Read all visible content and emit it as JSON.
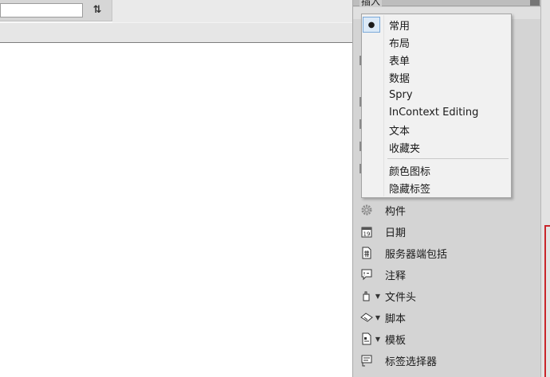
{
  "toolbar": {
    "search_value": "",
    "sort_icon_glyph": "⇅"
  },
  "panel": {
    "title": "插入",
    "items": [
      {
        "label": "构件",
        "icon": "widget-gear-icon",
        "caret": false
      },
      {
        "label": "日期",
        "icon": "calendar-date-icon",
        "caret": false
      },
      {
        "label": "服务器端包括",
        "icon": "server-include-icon",
        "caret": false
      },
      {
        "label": "注释",
        "icon": "comment-icon",
        "caret": false
      },
      {
        "label": "文件头",
        "icon": "file-head-icon",
        "caret": true
      },
      {
        "label": "脚本",
        "icon": "script-icon",
        "caret": true
      },
      {
        "label": "模板",
        "icon": "template-icon",
        "caret": true
      },
      {
        "label": "标签选择器",
        "icon": "tag-chooser-icon",
        "caret": false
      }
    ]
  },
  "dropdown": {
    "selected_mark": "●",
    "items": [
      {
        "label": "常用",
        "selected": true
      },
      {
        "label": "布局",
        "selected": false
      },
      {
        "label": "表单",
        "selected": false
      },
      {
        "label": "数据",
        "selected": false
      },
      {
        "label": "Spry",
        "selected": false
      },
      {
        "label": "InContext Editing",
        "selected": false
      },
      {
        "label": "文本",
        "selected": false
      },
      {
        "label": "收藏夹",
        "selected": false
      },
      {
        "label": "颜色图标",
        "selected": false
      },
      {
        "label": "隐藏标签",
        "selected": false
      }
    ]
  },
  "colors": {
    "panel_bg": "#d4d4d4",
    "menu_bg": "#f1f1f1",
    "selection_border": "#7aa9d9",
    "accent_red": "#c9262b"
  }
}
